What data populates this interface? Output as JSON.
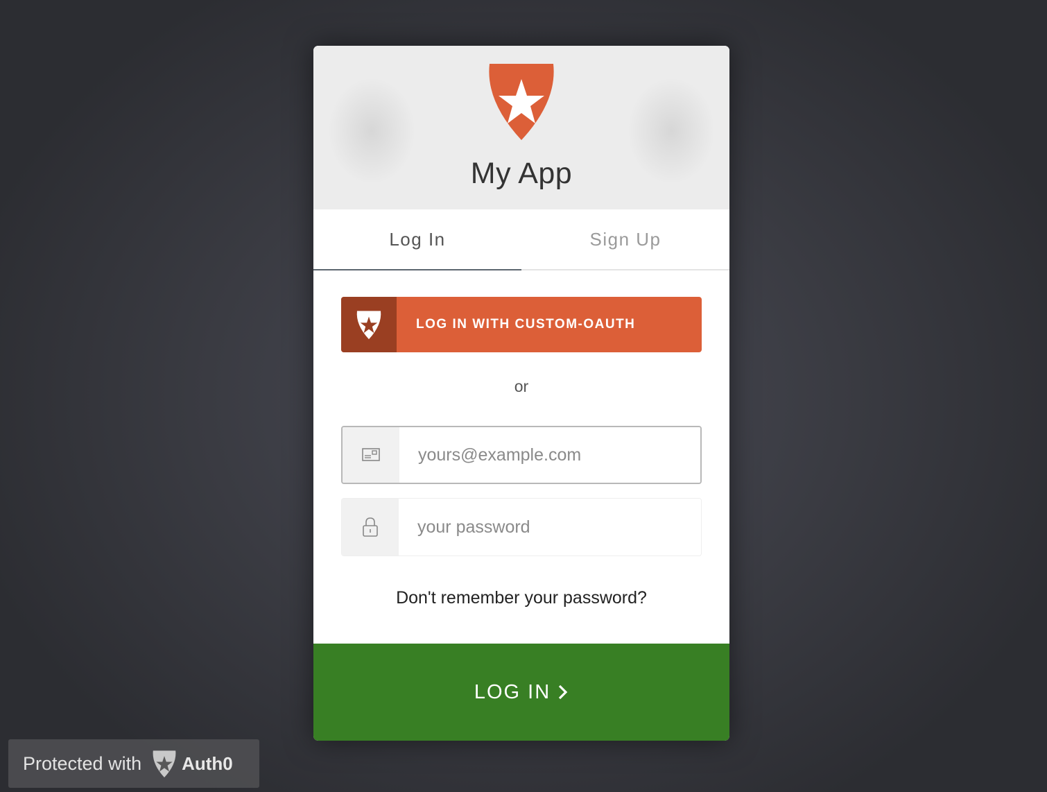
{
  "colors": {
    "brand_orange": "#dc5f38",
    "brand_dark_orange": "#9a3f22",
    "submit_green": "#387f24"
  },
  "header": {
    "logo_icon": "auth0-shield-star-icon",
    "app_title": "My App"
  },
  "tabs": [
    {
      "label": "Log In",
      "active": true
    },
    {
      "label": "Sign Up",
      "active": false
    }
  ],
  "social": {
    "icon": "auth0-shield-star-icon",
    "label": "LOG IN WITH CUSTOM-OAUTH"
  },
  "separator": "or",
  "email_field": {
    "icon": "envelope-icon",
    "placeholder": "yours@example.com",
    "value": ""
  },
  "password_field": {
    "icon": "lock-icon",
    "placeholder": "your password",
    "value": ""
  },
  "forgot_link": "Don't remember your password?",
  "submit": {
    "label": "LOG IN",
    "icon": "chevron-right-icon"
  },
  "badge": {
    "text": "Protected with",
    "icon": "auth0-shield-star-icon",
    "brand": "Auth0"
  }
}
